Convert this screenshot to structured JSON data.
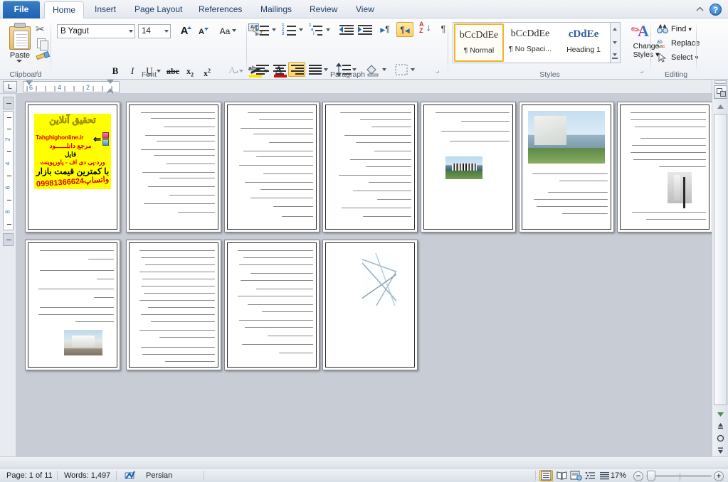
{
  "window": {
    "app": "Microsoft Word",
    "help_icon": "help-question-icon",
    "minimize_ribbon_icon": "chevron-up-icon"
  },
  "tabs": [
    {
      "label": "File",
      "active": false,
      "kind": "file"
    },
    {
      "label": "Home",
      "active": true
    },
    {
      "label": "Insert",
      "active": false
    },
    {
      "label": "Page Layout",
      "active": false
    },
    {
      "label": "References",
      "active": false
    },
    {
      "label": "Mailings",
      "active": false
    },
    {
      "label": "Review",
      "active": false
    },
    {
      "label": "View",
      "active": false
    }
  ],
  "ribbon": {
    "groups": [
      {
        "name": "Clipboard",
        "label": "Clipboard"
      },
      {
        "name": "Font",
        "label": "Font"
      },
      {
        "name": "Paragraph",
        "label": "Paragraph"
      },
      {
        "name": "Styles",
        "label": "Styles"
      },
      {
        "name": "Editing",
        "label": "Editing"
      }
    ],
    "clipboard": {
      "paste_label": "Paste",
      "cut_icon": "scissors-icon",
      "copy_icon": "copy-icon",
      "format_painter_icon": "format-painter-icon"
    },
    "font": {
      "font_name": "B Yagut",
      "font_size": "14",
      "grow_font": "A",
      "shrink_font": "A",
      "change_case": "Aa",
      "clear_formatting_icon": "clear-formatting-icon",
      "bold": "B",
      "italic": "I",
      "underline": "U",
      "strikethrough": "abc",
      "subscript": "x",
      "subscript_mark": "2",
      "superscript": "x",
      "superscript_mark": "2",
      "text_effects": "A",
      "highlight_letters": "ab",
      "highlight_color": "#ffe400",
      "font_color_letter": "A",
      "font_color": "#cf1010"
    },
    "paragraph": {
      "bullets_icon": "bullet-list-icon",
      "numbering_icon": "numbered-list-icon",
      "multilevel_icon": "multilevel-list-icon",
      "decrease_indent_icon": "decrease-indent-icon",
      "increase_indent_icon": "increase-indent-icon",
      "ltr_glyph": "¶",
      "rtl_glyph": "¶",
      "rtl_selected": true,
      "sort_icon": "sort-az-icon",
      "show_marks_glyph": "¶",
      "align_left_icon": "align-left-icon",
      "align_center_icon": "align-center-icon",
      "align_right_icon": "align-right-icon",
      "align_right_selected": true,
      "justify_icon": "justify-icon",
      "line_spacing_icon": "line-spacing-icon",
      "shading_icon": "shading-icon",
      "borders_icon": "borders-icon"
    },
    "styles": {
      "gallery": [
        {
          "preview": "bCcDdEe",
          "name": "¶ Normal",
          "selected": true,
          "serif": false,
          "bold": false,
          "color": "#2b2b2b"
        },
        {
          "preview": "bCcDdEe",
          "name": "¶ No Spaci...",
          "selected": false,
          "serif": false,
          "bold": false,
          "color": "#2b2b2b"
        },
        {
          "preview": "cDdEe",
          "name": "Heading 1",
          "selected": false,
          "serif": true,
          "bold": true,
          "color": "#2e5f9e"
        }
      ],
      "change_styles_line1": "Change",
      "change_styles_line2": "Styles"
    },
    "editing": {
      "find": "Find",
      "replace": "Replace",
      "select": "Select",
      "find_icon": "binoculars-icon",
      "replace_icon": "replace-icon",
      "select_icon": "cursor-arrow-icon"
    }
  },
  "rulers": {
    "tab_selector": "L",
    "horizontal_marks": [
      "6",
      "4",
      "2"
    ],
    "vertical_marks": [
      "2",
      "4",
      "6",
      "8"
    ]
  },
  "document": {
    "zoom_percent": "17%",
    "pages": [
      {
        "n": 1,
        "kind": "promo"
      },
      {
        "n": 2,
        "kind": "text"
      },
      {
        "n": 3,
        "kind": "text"
      },
      {
        "n": 4,
        "kind": "text"
      },
      {
        "n": 5,
        "kind": "text-image",
        "image": "glass-roof-building-photo"
      },
      {
        "n": 6,
        "kind": "image-text",
        "image": "colonnade-building-photo"
      },
      {
        "n": 7,
        "kind": "text-image",
        "image": "grey-corridor-photo"
      },
      {
        "n": 8,
        "kind": "text-image",
        "image": "white-hall-building-photo"
      },
      {
        "n": 9,
        "kind": "text"
      },
      {
        "n": 10,
        "kind": "text"
      },
      {
        "n": 11,
        "kind": "image-only",
        "image": "architectural-site-plan-sketch"
      }
    ],
    "promo_page": {
      "title": "تحقیق آنلاین",
      "site": "Tahghighonline.ir",
      "line_marja": "مرجع دانلــــــود",
      "line_file": "فایل",
      "line_formats": "ورد-پی دی اف - پاورپوینت",
      "line_price": "با کمترین قیمت بازار",
      "line_whatsapp": "واتساپ09981366624",
      "bg_color": "#ffff00"
    }
  },
  "status_bar": {
    "page": "Page: 1 of 11",
    "words": "Words: 1,497",
    "proofing_icon": "spellcheck-icon",
    "language": "Persian",
    "views": [
      {
        "name": "print-layout",
        "icon": "print-layout-icon",
        "selected": true
      },
      {
        "name": "full-screen-reading",
        "icon": "book-icon",
        "selected": false
      },
      {
        "name": "web-layout",
        "icon": "web-layout-icon",
        "selected": false
      },
      {
        "name": "outline",
        "icon": "outline-icon",
        "selected": false
      },
      {
        "name": "draft",
        "icon": "draft-icon",
        "selected": false
      }
    ],
    "zoom": "17%",
    "zoom_out": "−",
    "zoom_in": "+"
  }
}
